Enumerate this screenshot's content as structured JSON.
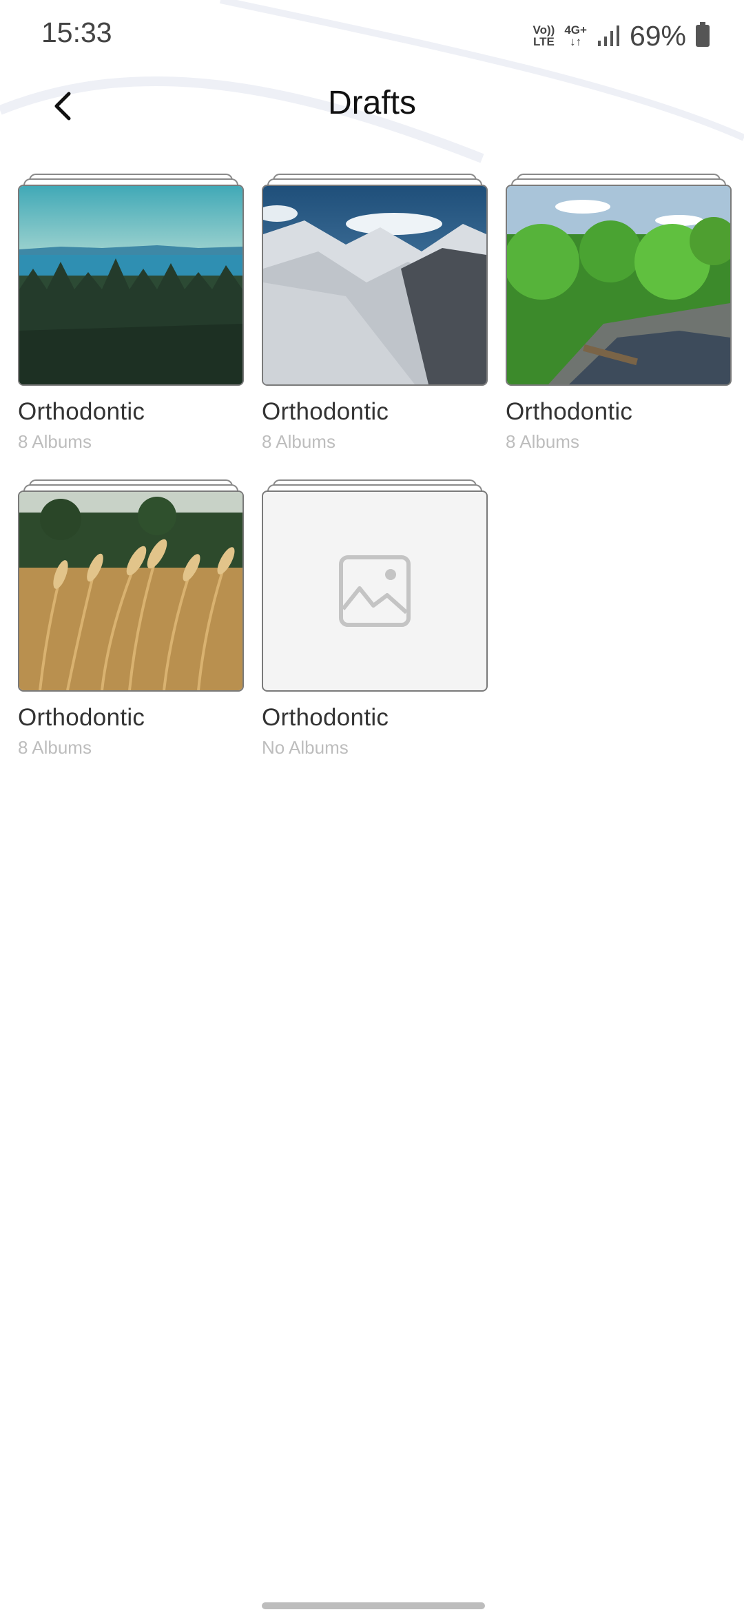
{
  "status_bar": {
    "time": "15:33",
    "network_volte": "Vo)) LTE",
    "network_4g": "4G+",
    "battery": "69%"
  },
  "header": {
    "title": "Drafts",
    "back_icon": "chevron-left-icon"
  },
  "albums": [
    {
      "name": "Orthodontic",
      "count": "8 Albums",
      "cover": "forest-lake"
    },
    {
      "name": "Orthodontic",
      "count": "8 Albums",
      "cover": "snowy-mountains"
    },
    {
      "name": "Orthodontic",
      "count": "8 Albums",
      "cover": "green-forest-stream"
    },
    {
      "name": "Orthodontic",
      "count": "8 Albums",
      "cover": "wheat-field"
    },
    {
      "name": "Orthodontic",
      "count": "No Albums",
      "cover": "placeholder-image-icon"
    }
  ]
}
